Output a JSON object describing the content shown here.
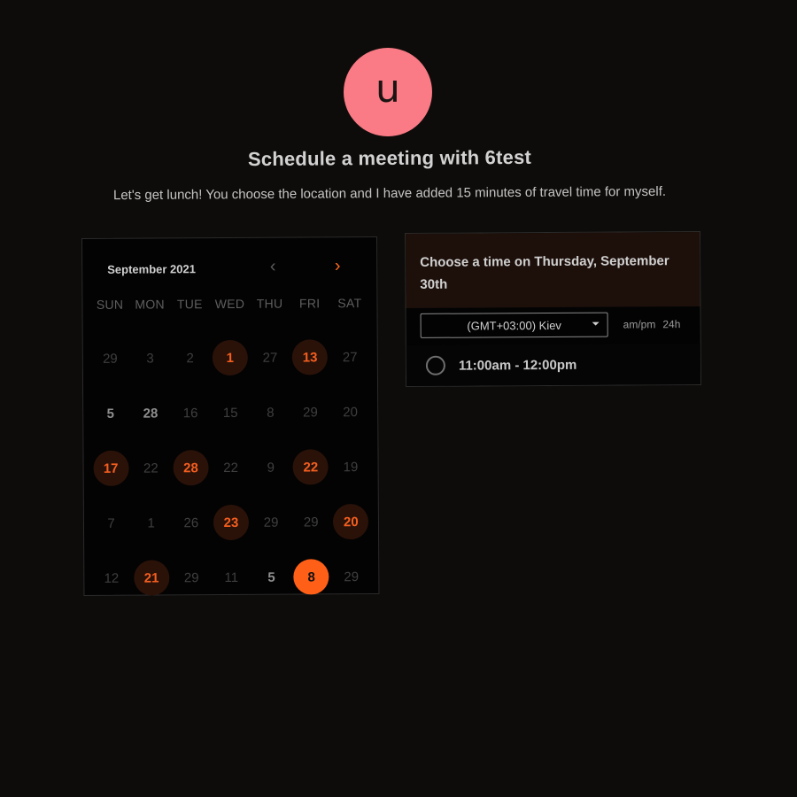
{
  "host": {
    "avatar_initial": "u",
    "avatar_color": "#fa7a85",
    "title": "Schedule a meeting with 6test",
    "description": "Let's get lunch! You choose the location and I have added 15 minutes of travel time for myself."
  },
  "calendar": {
    "month_label": "September 2021",
    "prev_icon": "chevron-left-icon",
    "next_icon": "chevron-right-icon",
    "weekdays": [
      "SUN",
      "MON",
      "TUE",
      "WED",
      "THU",
      "FRI",
      "SAT"
    ],
    "weeks": [
      [
        {
          "label": "29",
          "state": "muted"
        },
        {
          "label": "3",
          "state": "muted"
        },
        {
          "label": "2",
          "state": "muted"
        },
        {
          "label": "1",
          "state": "available"
        },
        {
          "label": "27",
          "state": "muted"
        },
        {
          "label": "13",
          "state": "available"
        },
        {
          "label": "27",
          "state": "muted"
        }
      ],
      [
        {
          "label": "5",
          "state": "plain"
        },
        {
          "label": "28",
          "state": "plain"
        },
        {
          "label": "16",
          "state": "muted"
        },
        {
          "label": "15",
          "state": "muted"
        },
        {
          "label": "8",
          "state": "muted"
        },
        {
          "label": "29",
          "state": "muted"
        },
        {
          "label": "20",
          "state": "muted"
        }
      ],
      [
        {
          "label": "17",
          "state": "available"
        },
        {
          "label": "22",
          "state": "muted"
        },
        {
          "label": "28",
          "state": "available"
        },
        {
          "label": "22",
          "state": "muted"
        },
        {
          "label": "9",
          "state": "muted"
        },
        {
          "label": "22",
          "state": "available"
        },
        {
          "label": "19",
          "state": "muted"
        }
      ],
      [
        {
          "label": "7",
          "state": "muted"
        },
        {
          "label": "1",
          "state": "muted"
        },
        {
          "label": "26",
          "state": "muted"
        },
        {
          "label": "23",
          "state": "available"
        },
        {
          "label": "29",
          "state": "muted"
        },
        {
          "label": "29",
          "state": "muted"
        },
        {
          "label": "20",
          "state": "available"
        }
      ],
      [
        {
          "label": "12",
          "state": "muted"
        },
        {
          "label": "21",
          "state": "available"
        },
        {
          "label": "29",
          "state": "muted"
        },
        {
          "label": "11",
          "state": "muted"
        },
        {
          "label": "5",
          "state": "plain"
        },
        {
          "label": "8",
          "state": "selected"
        },
        {
          "label": "29",
          "state": "muted"
        }
      ]
    ],
    "colors": {
      "accent": "#ff5f17",
      "available_bg": "#2a1209"
    }
  },
  "time_picker": {
    "title": "Choose a time on Thursday, September 30th",
    "timezone_value": "(GMT+03:00) Kiev",
    "format_12h": "am/pm",
    "format_24h": "24h",
    "slots": [
      "11:00am - 12:00pm"
    ]
  }
}
